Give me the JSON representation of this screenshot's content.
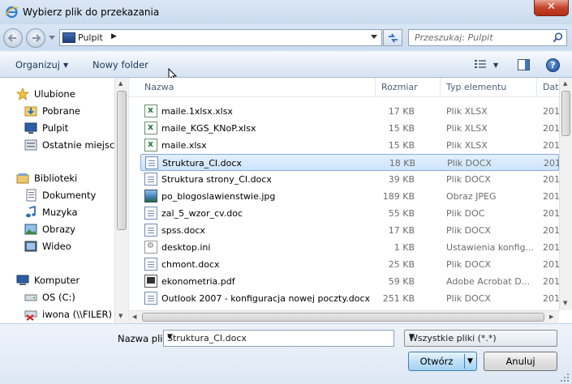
{
  "window": {
    "title": "Wybierz plik do przekazania",
    "close_glyph": "✕"
  },
  "nav": {
    "address": "Pulpit",
    "search_placeholder": "Przeszukaj: Pulpit"
  },
  "toolbar": {
    "organize": "Organizuj",
    "new_folder": "Nowy folder"
  },
  "sidebar": {
    "items": [
      {
        "label": "Ulubione",
        "icon": "star-icon"
      },
      {
        "label": "Pobrane",
        "icon": "downloads-folder-icon"
      },
      {
        "label": "Pulpit",
        "icon": "desktop-icon"
      },
      {
        "label": "Ostatnie miejsca",
        "icon": "recent-places-icon"
      },
      {
        "label": "Biblioteki",
        "icon": "libraries-icon"
      },
      {
        "label": "Dokumenty",
        "icon": "documents-icon"
      },
      {
        "label": "Muzyka",
        "icon": "music-icon"
      },
      {
        "label": "Obrazy",
        "icon": "pictures-icon"
      },
      {
        "label": "Wideo",
        "icon": "video-icon"
      },
      {
        "label": "Komputer",
        "icon": "computer-icon"
      },
      {
        "label": "OS (C:)",
        "icon": "drive-icon"
      },
      {
        "label": "iwona (\\\\FILER) (",
        "icon": "network-drive-icon"
      }
    ]
  },
  "columns": {
    "name": "Nazwa",
    "size": "Rozmiar",
    "type": "Typ elementu",
    "date": "Dat"
  },
  "files": [
    {
      "name": "maile.1xlsx.xlsx",
      "size": "17 KB",
      "type": "Plik XLSX",
      "date": "201",
      "icon": "xlsx"
    },
    {
      "name": "maile_KGS_KNoP.xlsx",
      "size": "15 KB",
      "type": "Plik XLSX",
      "date": "201",
      "icon": "xlsx"
    },
    {
      "name": "maile.xlsx",
      "size": "15 KB",
      "type": "Plik XLSX",
      "date": "201",
      "icon": "xlsx"
    },
    {
      "name": "Struktura_CI.docx",
      "size": "18 KB",
      "type": "Plik DOCX",
      "date": "201",
      "icon": "doc"
    },
    {
      "name": "Struktura strony_CI.docx",
      "size": "39 KB",
      "type": "Plik DOCX",
      "date": "201",
      "icon": "doc"
    },
    {
      "name": "po_blogoslawienstwie.jpg",
      "size": "189 KB",
      "type": "Obraz JPEG",
      "date": "201",
      "icon": "jpg"
    },
    {
      "name": "zal_5_wzor_cv.doc",
      "size": "55 KB",
      "type": "Plik DOC",
      "date": "201",
      "icon": "doc"
    },
    {
      "name": "spss.docx",
      "size": "17 KB",
      "type": "Plik DOCX",
      "date": "201",
      "icon": "doc"
    },
    {
      "name": "desktop.ini",
      "size": "1 KB",
      "type": "Ustawienia konfig...",
      "date": "201",
      "icon": "ini"
    },
    {
      "name": "chmont.docx",
      "size": "25 KB",
      "type": "Plik DOCX",
      "date": "201",
      "icon": "doc"
    },
    {
      "name": "ekonometria.pdf",
      "size": "59 KB",
      "type": "Adobe Acrobat D...",
      "date": "201",
      "icon": "pdf"
    },
    {
      "name": "Outlook 2007 - konfiguracja nowej poczty.docx",
      "size": "251 KB",
      "type": "Plik DOCX",
      "date": "201",
      "icon": "doc"
    }
  ],
  "selected_index": 3,
  "bottom": {
    "filename_label": "Nazwa pliku:",
    "filename_value": "Struktura_CI.docx",
    "filter_value": "Wszystkie pliki (*.*)",
    "open_label": "Otwórz",
    "cancel_label": "Anuluj"
  },
  "colors": {
    "selection": "#cde4fb",
    "selection_border": "#84acdd",
    "close_red": "#c7432b"
  }
}
